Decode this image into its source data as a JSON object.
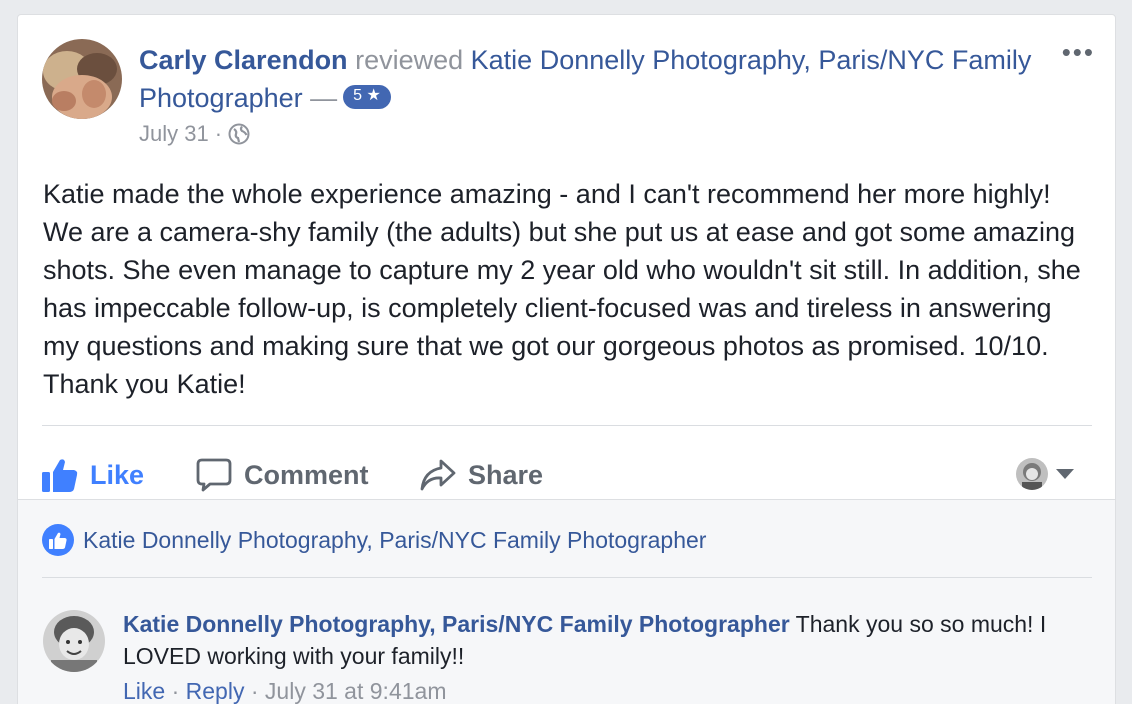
{
  "post": {
    "author": "Carly Clarendon",
    "verb": "reviewed",
    "page_name": "Katie Donnelly Photography, Paris/NYC Family Photographer",
    "dash": "—",
    "rating": "5 ★",
    "date": "July 31",
    "separator": "·",
    "privacy_icon": "globe-icon",
    "more_icon": "•••",
    "body": "Katie made the whole experience amazing - and I can't recommend her more highly! We are a camera-shy family (the adults) but she put us at ease and got some amazing shots. She even manage to capture my 2 year old who wouldn't sit still. In addition, she has impeccable follow-up, is completely client-focused was and tireless in answering my questions and making sure that we got our gorgeous photos as promised. 10/10. Thank you Katie!"
  },
  "actions": {
    "like": "Like",
    "comment": "Comment",
    "share": "Share"
  },
  "likes": {
    "liked_by": "Katie Donnelly Photography, Paris/NYC Family Photographer"
  },
  "comment": {
    "author": "Katie Donnelly Photography, Paris/NYC Family Photographer",
    "text": " Thank you so so much! I LOVED working with your family!!",
    "like": "Like",
    "dot": " · ",
    "reply": "Reply",
    "timestamp": "July 31 at 9:41am"
  },
  "colors": {
    "link": "#365899",
    "like_blue": "#4080ff",
    "badge_blue": "#4267b2",
    "muted": "#90949c"
  }
}
